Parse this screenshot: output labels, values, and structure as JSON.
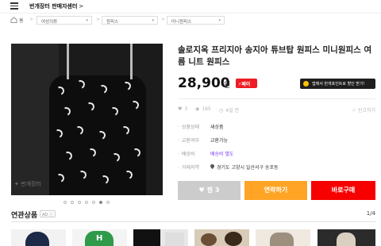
{
  "header": {
    "brand": "번개장터 판매자센터",
    "brand_chevron": ">"
  },
  "breadcrumb": {
    "home": "홈",
    "separator": ">",
    "levels": [
      "여성의류",
      "원피스",
      "미니원피스"
    ]
  },
  "product": {
    "title": "솔로지옥 프리지아 송지아 튜브탑 원피스 미니원피스 여름 니트 원피스",
    "price": "28,900",
    "currency": "원",
    "pay_badge": "⚡페이",
    "promo_text": "앱에서 번개포인트로 할인 받기!",
    "watermark": "번개장터",
    "image_count": 7,
    "image_index": 6,
    "stats": {
      "likes": "3",
      "views": "165",
      "time": "4일 전",
      "report": "신고하기"
    },
    "details": [
      {
        "label": "상품상태",
        "value": "새상품",
        "link": false
      },
      {
        "label": "교환여부",
        "value": "교환가능",
        "link": false
      },
      {
        "label": "배송비",
        "value": "배송비 별도",
        "link": true
      },
      {
        "label": "거래지역",
        "value": "경기도 고양시 일산서구 송포동",
        "link": false
      }
    ],
    "actions": {
      "like": "찜 3",
      "chat": "연락하기",
      "buy": "바로구매"
    }
  },
  "related": {
    "title": "연관상품",
    "ad_badge": "AD ⓘ",
    "page": "1/4"
  },
  "colors": {
    "buy": "#f70000",
    "chat": "#ffa425",
    "like": "#cccccc",
    "pay_badge": "#ee1c24",
    "shipping_link": "#7d3cff"
  },
  "icons": [
    "hamburger-icon",
    "home-icon",
    "heart-icon",
    "eye-icon",
    "clock-icon",
    "siren-icon",
    "location-pin-icon",
    "coin-icon"
  ]
}
